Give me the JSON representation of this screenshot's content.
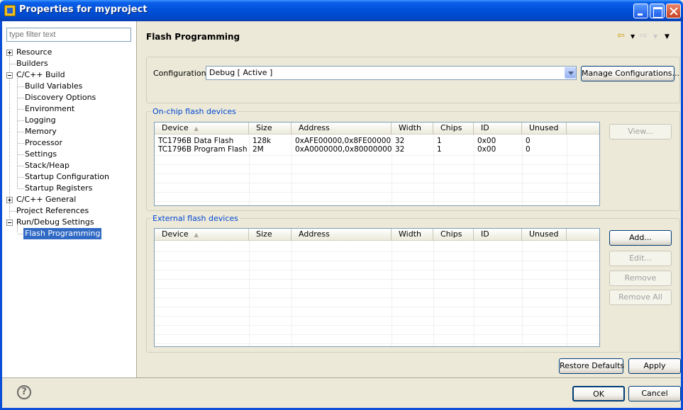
{
  "window": {
    "title": "Properties for myproject"
  },
  "filter": {
    "placeholder": "type filter text"
  },
  "tree": [
    {
      "label": "Resource"
    },
    {
      "label": "Builders"
    },
    {
      "label": "C/C++ Build"
    },
    {
      "label": "Build Variables"
    },
    {
      "label": "Discovery Options"
    },
    {
      "label": "Environment"
    },
    {
      "label": "Logging"
    },
    {
      "label": "Memory"
    },
    {
      "label": "Processor"
    },
    {
      "label": "Settings"
    },
    {
      "label": "Stack/Heap"
    },
    {
      "label": "Startup Configuration"
    },
    {
      "label": "Startup Registers"
    },
    {
      "label": "C/C++ General"
    },
    {
      "label": "Project References"
    },
    {
      "label": "Run/Debug Settings"
    },
    {
      "label": "Flash Programming"
    }
  ],
  "page": {
    "title": "Flash Programming"
  },
  "configuration": {
    "label": "Configuration:",
    "value": "Debug  [ Active ]",
    "manage_button": "Manage Configurations..."
  },
  "onchip": {
    "group_label": "On-chip flash devices",
    "columns": [
      "Device",
      "Size",
      "Address",
      "Width",
      "Chips",
      "ID",
      "Unused"
    ],
    "rows": [
      [
        "TC1796B Data Flash",
        "128k",
        "0xAFE00000,0x8FE00000",
        "32",
        "1",
        "0x00",
        "0"
      ],
      [
        "TC1796B Program Flash",
        "2M",
        "0xA0000000,0x80000000",
        "32",
        "1",
        "0x00",
        "0"
      ]
    ],
    "view_button": "View..."
  },
  "external": {
    "group_label": "External flash devices",
    "columns": [
      "Device",
      "Size",
      "Address",
      "Width",
      "Chips",
      "ID",
      "Unused"
    ],
    "rows": [],
    "add_button": "Add...",
    "edit_button": "Edit...",
    "remove_button": "Remove",
    "remove_all_button": "Remove All"
  },
  "footer": {
    "restore_button": "Restore Defaults",
    "apply_button": "Apply",
    "ok_button": "OK",
    "cancel_button": "Cancel",
    "help_glyph": "?"
  },
  "nav_icons": [
    "back-arrow-icon",
    "forward-arrow-icon",
    "view-menu-icon"
  ]
}
